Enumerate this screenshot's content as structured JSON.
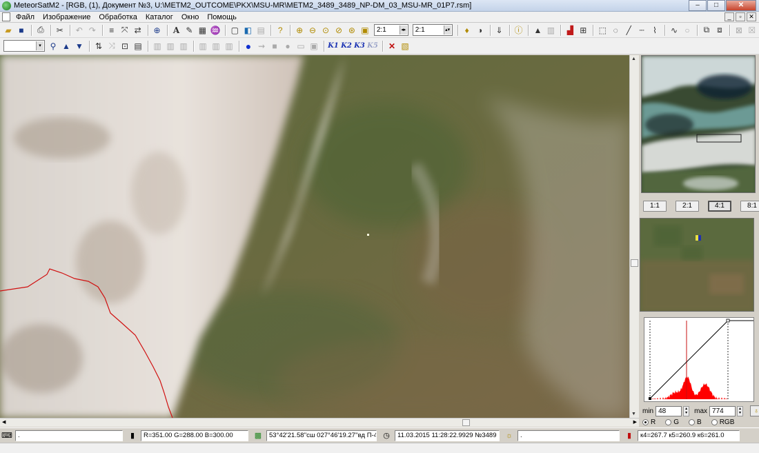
{
  "window": {
    "title": "MeteorSatM2 - [RGB, (1), Документ №3, U:\\METM2_OUTCOME\\PKX\\MSU-MR\\METM2_3489_3489_NP-DM_03_MSU-MR_01P7.rsm]",
    "min_label": "–",
    "max_label": "□",
    "close_label": "✕"
  },
  "menu": {
    "items": [
      "Файл",
      "Изображение",
      "Обработка",
      "Каталог",
      "Окно",
      "Помощь"
    ],
    "mdi": [
      "_",
      "▫",
      "✕"
    ]
  },
  "toolbar1": {
    "scale_combo_1": "2:1",
    "scale_combo_2": "2:1"
  },
  "toolbar2": {
    "k_buttons": [
      "K1",
      "K2",
      "K3",
      "K5"
    ]
  },
  "icons": {
    "open": "folder-open-icon",
    "save": "save-icon",
    "print": "print-icon",
    "cut": "scissors-icon",
    "zoom_in": "zoom-in-icon",
    "zoom_out": "zoom-out-icon",
    "info": "info-icon",
    "histogram": "histogram-icon"
  },
  "right_panel": {
    "zoom_buttons": [
      "1:1",
      "2:1",
      "4:1",
      "8:1"
    ],
    "active_zoom": "4:1",
    "min_label": "min",
    "min_value": "48",
    "max_label": "max",
    "max_value": "774",
    "channels": [
      "R",
      "G",
      "B",
      "RGB"
    ],
    "selected_channel": "R"
  },
  "histogram": {
    "line_color": "#c81010",
    "fill_color": "#ff0000"
  },
  "status": {
    "field1": ".",
    "rgb_values": "R=351.00 G=288.00 B=300.00",
    "coords": "53°42'21.58''сш 027°46'19.27''вд П-42",
    "datetime": "11.03.2015 11:28:22.9929  №3489",
    "field5": ".",
    "coeffs": "к4=267.7 к5=260.9 к6=261.0"
  },
  "colors": {
    "border_line": "#d01010",
    "terrain": "#5d6b3e",
    "cloud": "#e6e0dc"
  }
}
